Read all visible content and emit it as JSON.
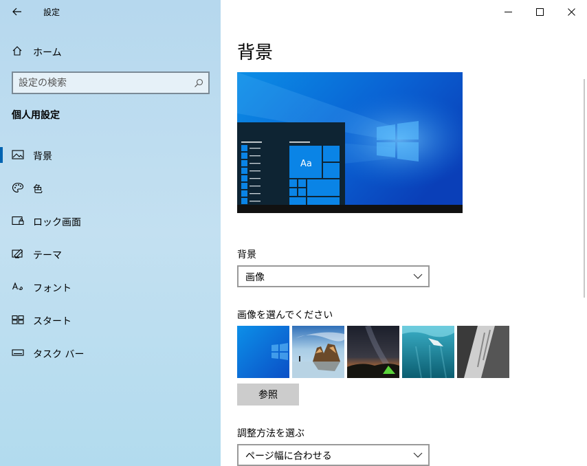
{
  "window": {
    "title": "設定",
    "controls": {
      "minimize": "minimize-icon",
      "maximize": "maximize-icon",
      "close": "close-icon"
    }
  },
  "sidebar": {
    "back_icon": "back-arrow-icon",
    "home_label": "ホーム",
    "search": {
      "placeholder": "設定の検索",
      "value": ""
    },
    "section_title": "個人用設定",
    "items": [
      {
        "label": "背景",
        "icon": "picture-icon",
        "selected": true
      },
      {
        "label": "色",
        "icon": "palette-icon",
        "selected": false
      },
      {
        "label": "ロック画面",
        "icon": "lock-screen-icon",
        "selected": false
      },
      {
        "label": "テーマ",
        "icon": "theme-icon",
        "selected": false
      },
      {
        "label": "フォント",
        "icon": "font-icon",
        "selected": false
      },
      {
        "label": "スタート",
        "icon": "start-icon",
        "selected": false
      },
      {
        "label": "タスク バー",
        "icon": "taskbar-icon",
        "selected": false
      }
    ]
  },
  "main": {
    "title": "背景",
    "preview": {
      "tile_text": "Aa"
    },
    "background_label": "背景",
    "background_value": "画像",
    "choose_image_label": "画像を選んでください",
    "browse_label": "参照",
    "fit_label": "調整方法を選ぶ",
    "fit_value": "ページ幅に合わせる"
  },
  "colors": {
    "accent": "#0063b1",
    "sidebar_bg": "#bfdff0",
    "button_bg": "#cccccc"
  }
}
